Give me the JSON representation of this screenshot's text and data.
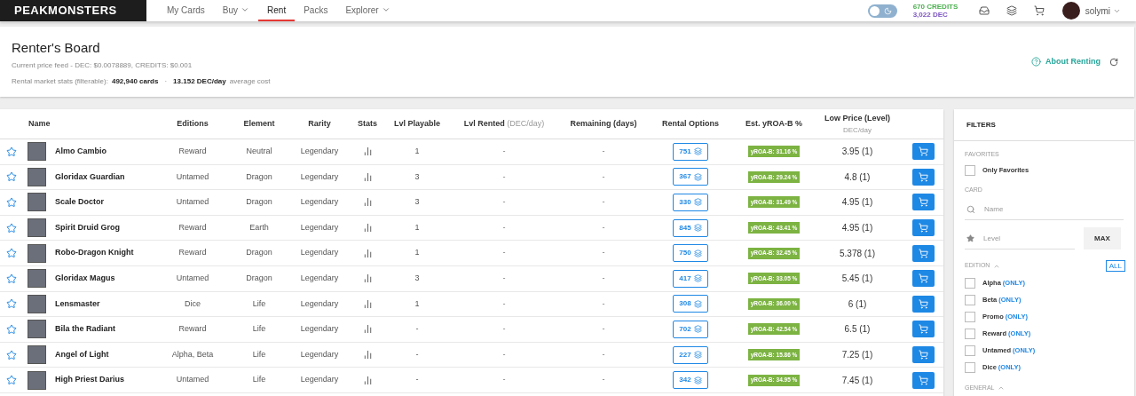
{
  "nav": {
    "logo": "PEAKMONSTERS",
    "items": [
      {
        "label": "My Cards",
        "selected": false,
        "dropdown": false
      },
      {
        "label": "Buy",
        "selected": false,
        "dropdown": true
      },
      {
        "label": "Rent",
        "selected": true,
        "dropdown": false
      },
      {
        "label": "Packs",
        "selected": false,
        "dropdown": false
      },
      {
        "label": "Explorer",
        "selected": false,
        "dropdown": true
      }
    ],
    "dark_mode": false,
    "credits": "670 CREDITS",
    "dec": "3,022 DEC",
    "user": "solymi"
  },
  "header": {
    "title": "Renter's Board",
    "price_feed": "Current price feed - DEC: $0.0078889, CREDITS: $0.001",
    "stats_label": "Rental market stats (filterable):",
    "cards": "492,940 cards",
    "separator": "·",
    "avg": "13.152 DEC/day",
    "avg_suffix": "average cost",
    "about": "About Renting"
  },
  "table": {
    "columns": [
      {
        "label": "Name"
      },
      {
        "label": "Editions"
      },
      {
        "label": "Element"
      },
      {
        "label": "Rarity"
      },
      {
        "label": "Stats"
      },
      {
        "label": "Lvl Playable"
      },
      {
        "label": "Lvl Rented",
        "note": "(DEC/day)"
      },
      {
        "label": "Remaining (days)"
      },
      {
        "label": "Rental Options"
      },
      {
        "label": "Est. yROA-B %"
      },
      {
        "label": "Low Price (Level)",
        "sub": "DEC/day"
      }
    ],
    "rows": [
      {
        "favorite": false,
        "name": "Almo Cambio",
        "edition": "Reward",
        "element": "Neutral",
        "rarity": "Legendary",
        "lvl_playable": "1",
        "lvl_rented": "-",
        "remaining": "-",
        "options": "751",
        "yroa": "yROA-B: 31.16 %",
        "price": "3.95 (1)"
      },
      {
        "favorite": false,
        "name": "Gloridax Guardian",
        "edition": "Untamed",
        "element": "Dragon",
        "rarity": "Legendary",
        "lvl_playable": "3",
        "lvl_rented": "-",
        "remaining": "-",
        "options": "367",
        "yroa": "yROA-B: 29.24 %",
        "price": "4.8 (1)"
      },
      {
        "favorite": false,
        "name": "Scale Doctor",
        "edition": "Untamed",
        "element": "Dragon",
        "rarity": "Legendary",
        "lvl_playable": "3",
        "lvl_rented": "-",
        "remaining": "-",
        "options": "330",
        "yroa": "yROA-B: 31.49 %",
        "price": "4.95 (1)"
      },
      {
        "favorite": false,
        "name": "Spirit Druid Grog",
        "edition": "Reward",
        "element": "Earth",
        "rarity": "Legendary",
        "lvl_playable": "1",
        "lvl_rented": "-",
        "remaining": "-",
        "options": "845",
        "yroa": "yROA-B: 43.41 %",
        "price": "4.95 (1)"
      },
      {
        "favorite": false,
        "name": "Robo-Dragon Knight",
        "edition": "Reward",
        "element": "Dragon",
        "rarity": "Legendary",
        "lvl_playable": "1",
        "lvl_rented": "-",
        "remaining": "-",
        "options": "750",
        "yroa": "yROA-B: 32.45 %",
        "price": "5.378 (1)"
      },
      {
        "favorite": false,
        "name": "Gloridax Magus",
        "edition": "Untamed",
        "element": "Dragon",
        "rarity": "Legendary",
        "lvl_playable": "3",
        "lvl_rented": "-",
        "remaining": "-",
        "options": "417",
        "yroa": "yROA-B: 33.05 %",
        "price": "5.45 (1)"
      },
      {
        "favorite": false,
        "name": "Lensmaster",
        "edition": "Dice",
        "element": "Life",
        "rarity": "Legendary",
        "lvl_playable": "1",
        "lvl_rented": "-",
        "remaining": "-",
        "options": "308",
        "yroa": "yROA-B: 36.00 %",
        "price": "6 (1)"
      },
      {
        "favorite": false,
        "name": "Bila the Radiant",
        "edition": "Reward",
        "element": "Life",
        "rarity": "Legendary",
        "lvl_playable": "-",
        "lvl_rented": "-",
        "remaining": "-",
        "options": "702",
        "yroa": "yROA-B: 42.54 %",
        "price": "6.5 (1)"
      },
      {
        "favorite": false,
        "name": "Angel of Light",
        "edition": "Alpha, Beta",
        "element": "Life",
        "rarity": "Legendary",
        "lvl_playable": "-",
        "lvl_rented": "-",
        "remaining": "-",
        "options": "227",
        "yroa": "yROA-B: 15.86 %",
        "price": "7.25 (1)"
      },
      {
        "favorite": false,
        "name": "High Priest Darius",
        "edition": "Untamed",
        "element": "Life",
        "rarity": "Legendary",
        "lvl_playable": "-",
        "lvl_rented": "-",
        "remaining": "-",
        "options": "342",
        "yroa": "yROA-B: 34.95 %",
        "price": "7.45 (1)"
      }
    ]
  },
  "filters": {
    "title": "FILTERS",
    "favorites_label": "FAVORITES",
    "only_favorites": {
      "label": "Only Favorites",
      "checked": false
    },
    "card_label": "CARD",
    "name_placeholder": "Name",
    "level_placeholder": "Level",
    "max": "MAX",
    "edition_label": "EDITION",
    "all": "ALL",
    "editions": [
      {
        "label": "Alpha",
        "only": "(ONLY)",
        "checked": false
      },
      {
        "label": "Beta",
        "only": "(ONLY)",
        "checked": false
      },
      {
        "label": "Promo",
        "only": "(ONLY)",
        "checked": false
      },
      {
        "label": "Reward",
        "only": "(ONLY)",
        "checked": false
      },
      {
        "label": "Untamed",
        "only": "(ONLY)",
        "checked": false
      },
      {
        "label": "Dice",
        "only": "(ONLY)",
        "checked": false
      }
    ],
    "general_label": "GENERAL"
  }
}
